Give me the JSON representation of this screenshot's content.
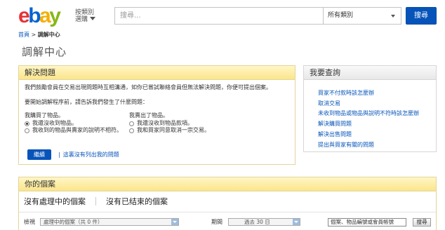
{
  "header": {
    "logo_letters": [
      "e",
      "b",
      "a",
      "y"
    ],
    "category_button": {
      "line1": "按類別",
      "line2": "選購"
    },
    "search": {
      "placeholder": "搜尋...",
      "category": "所有類別",
      "button": "搜尋"
    }
  },
  "breadcrumb": {
    "home": "首頁",
    "separator": ">",
    "current": "調解中心"
  },
  "page_title": "調解中心",
  "resolve_panel": {
    "title": "解決問題",
    "intro": "我們鼓勵會員在交易出現問題時互相溝通，如你已嘗試聯絡會員但無法解決問題，你便可提出個案。",
    "prompt": "要開始調解程序前，請告訴我們發生了什麼問題：",
    "buyer": {
      "title": "我購買了物品。",
      "options": [
        {
          "label": "我還沒收到物品。",
          "selected": true
        },
        {
          "label": "我收到的物品與賣家的說明不相符。",
          "selected": false
        }
      ]
    },
    "seller": {
      "title": "我賣出了物品。",
      "options": [
        {
          "label": "我還沒收到物品款項。",
          "selected": false
        },
        {
          "label": "我和買家同意取消一宗交易。",
          "selected": false
        }
      ]
    },
    "continue_button": "繼續",
    "help_link": "這裏沒有列出我的問題",
    "help_separator": "|"
  },
  "query_panel": {
    "title": "我要查詢",
    "links": [
      "買家不付款時該怎麼辦",
      "取消交易",
      "未收到物品或物品與說明不符時該怎麼辦",
      "解決購買問題",
      "解決出售問題",
      "提出與買家有關的問題"
    ]
  },
  "cases_panel": {
    "title": "你的個案",
    "tabs": [
      "沒有處理中的個案",
      "沒有已结束的個案"
    ],
    "filter": {
      "view_label": "檢視",
      "view_value": "處理中的個案（共 0 件）",
      "period_label": "期間",
      "period_value": "過去 30 日",
      "search_value": "個案、物品編號或會員帳號",
      "search_button": "搜尋"
    }
  },
  "colors": {
    "accent_blue": "#0654ba",
    "panel_header": "#fbe58a",
    "logo_red": "#e53238",
    "logo_blue": "#0064d2",
    "logo_yellow": "#f5af02",
    "logo_green": "#86b817"
  }
}
